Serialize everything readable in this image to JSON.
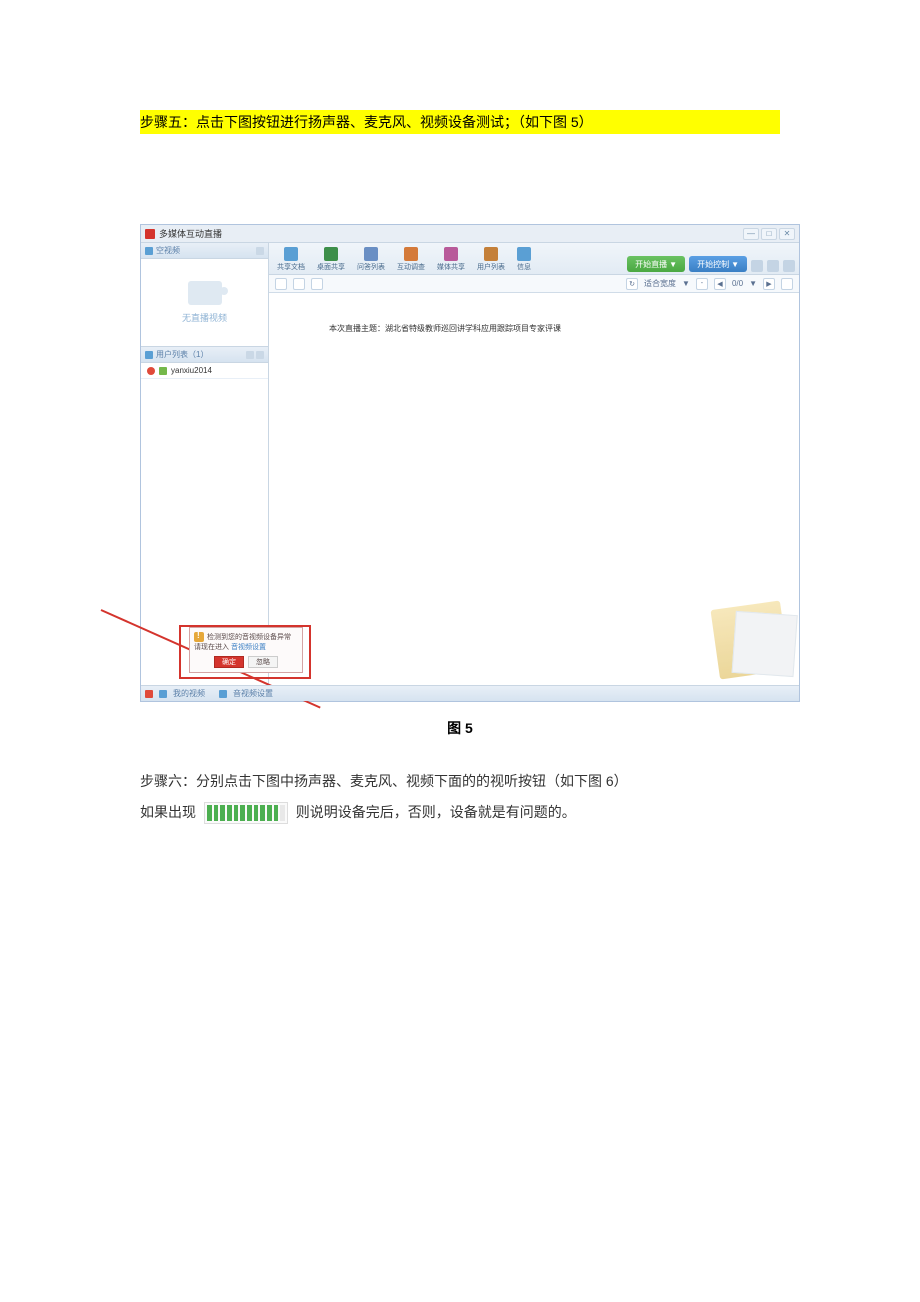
{
  "step5_text": "步骤五：点击下图按钮进行扬声器、麦克风、视频设备测试；（如下图 5）",
  "caption": "图 5",
  "step6_line1": "步骤六：分别点击下图中扬声器、麦克风、视频下面的的视听按钮（如下图 6）",
  "step6_prefix": "如果出现",
  "step6_suffix": " 则说明设备完后，否则，设备就是有问题的。",
  "app": {
    "title": "多媒体互动直播",
    "video_panel_title": "空视频",
    "no_video_text": "无直播视频",
    "userlist_title": "用户列表（1）",
    "user": "yanxiu2014",
    "toolbar": {
      "t1": "共享文档",
      "t2": "桌面共享",
      "t3": "问答列表",
      "t4": "互动调查",
      "t5": "媒体共享",
      "t6": "用户列表",
      "t7": "信息"
    },
    "btn_start": "开始直播",
    "btn_control": "开始控制",
    "arrow": "▼",
    "fit_label": "适合宽度",
    "page_indicator": "0/0",
    "content_title": "本次直播主题：湖北省特级教师巡回讲学科应用跟踪项目专家评课",
    "popup": {
      "line1": "检测到您的音视频设备异常",
      "line2_a": "请现在进入 ",
      "line2_b": "音视频设置",
      "btn_ok": "确定",
      "btn_ignore": "忽略"
    },
    "bottom_tab1": "我的视频",
    "bottom_tab2": "音视频设置"
  }
}
